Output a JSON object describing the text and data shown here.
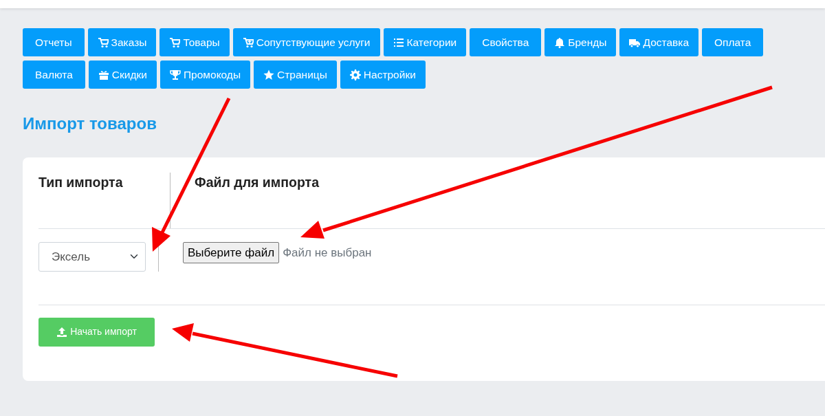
{
  "nav_buttons": [
    "Отчеты",
    "Заказы",
    "Товары",
    "Сопутствующие услуги",
    "Категории",
    "Свойства",
    "Бренды",
    "Доставка",
    "Оплата",
    "Валюта",
    "Скидки",
    "Промокоды",
    "Страницы",
    "Настройки"
  ],
  "page_title": "Импорт товаров",
  "import_form": {
    "columns": [
      "Тип импорта",
      "Файл для импорта"
    ],
    "import_type": {
      "value": "Эксель"
    },
    "file_button": "Выберите файл",
    "file_status": "Файл не выбран",
    "submit_button": "Начать импорт"
  }
}
